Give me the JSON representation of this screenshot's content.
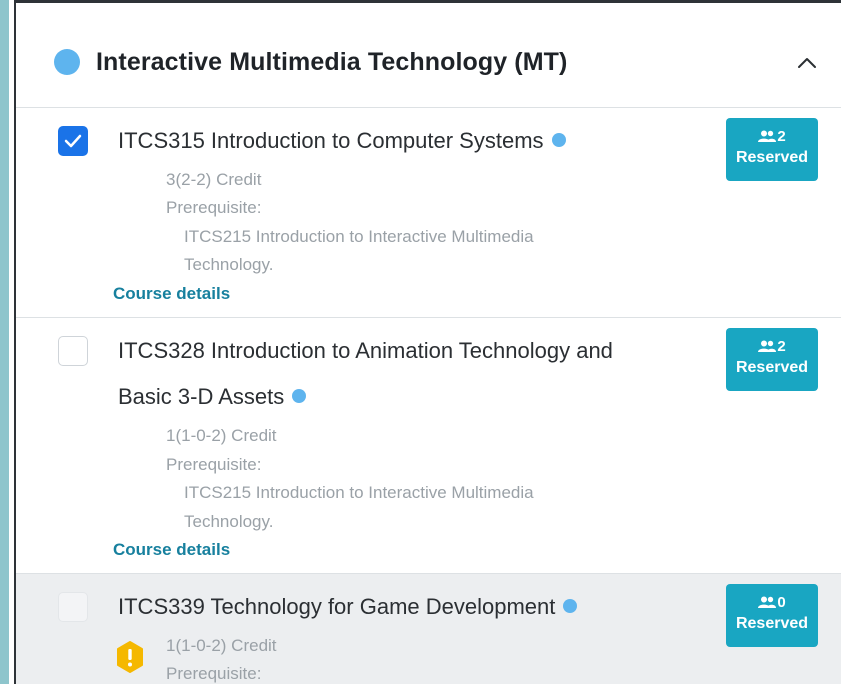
{
  "section": {
    "title": "Interactive Multimedia Technology (MT)",
    "dot_color": "#5eb4ee",
    "collapse_icon": "chevron-up-icon"
  },
  "courses": [
    {
      "title": "ITCS315 Introduction to Computer Systems",
      "checked": true,
      "credit": "3(2-2) Credit",
      "prereq_label": "Prerequisite:",
      "prereq_line1": "ITCS215 Introduction to Interactive Multimedia",
      "prereq_line2": "Technology.",
      "details_label": "Course details",
      "reserved_count": "2",
      "reserved_label": "Reserved"
    },
    {
      "title_line1": "ITCS328 Introduction to Animation Technology and",
      "title_line2": "Basic 3-D Assets",
      "checked": false,
      "credit": "1(1-0-2) Credit",
      "prereq_label": "Prerequisite:",
      "prereq_line1": "ITCS215 Introduction to Interactive Multimedia",
      "prereq_line2": "Technology.",
      "details_label": "Course details",
      "reserved_count": "2",
      "reserved_label": "Reserved"
    },
    {
      "title": "ITCS339 Technology for Game Development",
      "checked": false,
      "disabled": true,
      "warning_icon": "warning-icon",
      "credit": "1(1-0-2) Credit",
      "prereq_label": "Prerequisite:",
      "reserved_count": "0",
      "reserved_label": "Reserved"
    }
  ],
  "colors": {
    "checkbox_checked": "#1a73e8",
    "badge": "#19a6c2",
    "link": "#17809e",
    "warning": "#f5b800"
  }
}
